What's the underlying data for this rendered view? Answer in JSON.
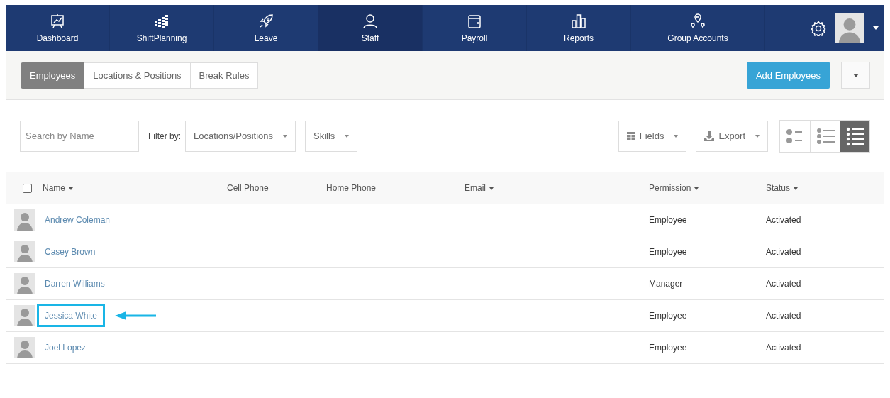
{
  "nav": {
    "items": [
      {
        "label": "Dashboard",
        "kind": "dashboard",
        "selected": false
      },
      {
        "label": "ShiftPlanning",
        "kind": "shift",
        "selected": false
      },
      {
        "label": "Leave",
        "kind": "leave",
        "selected": false
      },
      {
        "label": "Staff",
        "kind": "staff",
        "selected": true
      },
      {
        "label": "Payroll",
        "kind": "payroll",
        "selected": false
      },
      {
        "label": "Reports",
        "kind": "reports",
        "selected": false
      },
      {
        "label": "Group Accounts",
        "kind": "group",
        "selected": false
      }
    ]
  },
  "subtabs": [
    {
      "label": "Employees",
      "selected": true
    },
    {
      "label": "Locations & Positions",
      "selected": false
    },
    {
      "label": "Break Rules",
      "selected": false
    }
  ],
  "add_button": "Add Employees",
  "search": {
    "placeholder": "Search by Name"
  },
  "filter_label": "Filter by:",
  "filters": [
    "Locations/Positions",
    "Skills"
  ],
  "fields_button": "Fields",
  "export_button": "Export",
  "view_modes": [
    {
      "kind": "large",
      "selected": false
    },
    {
      "kind": "medium",
      "selected": false
    },
    {
      "kind": "compact",
      "selected": true
    }
  ],
  "table": {
    "select_all_checked": false,
    "columns": [
      {
        "label": "Name",
        "sortable": true
      },
      {
        "label": "Cell Phone",
        "sortable": false
      },
      {
        "label": "Home Phone",
        "sortable": false
      },
      {
        "label": "Email",
        "sortable": true
      },
      {
        "label": "Permission",
        "sortable": true
      },
      {
        "label": "Status",
        "sortable": true
      }
    ],
    "rows": [
      {
        "name": "Andrew Coleman",
        "permission": "Employee",
        "status": "Activated",
        "highlighted": false
      },
      {
        "name": "Casey Brown",
        "permission": "Employee",
        "status": "Activated",
        "highlighted": false
      },
      {
        "name": "Darren Williams",
        "permission": "Manager",
        "status": "Activated",
        "highlighted": false
      },
      {
        "name": "Jessica White",
        "permission": "Employee",
        "status": "Activated",
        "highlighted": true
      },
      {
        "name": "Joel Lopez",
        "permission": "Employee",
        "status": "Activated",
        "highlighted": false
      }
    ]
  }
}
